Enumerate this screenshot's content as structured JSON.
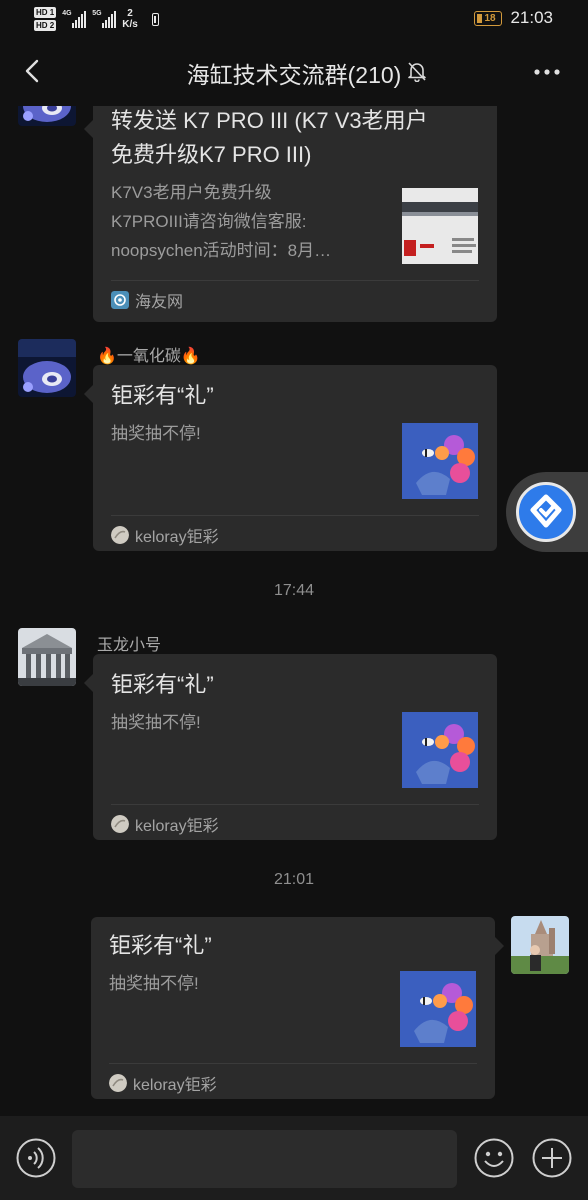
{
  "status_bar": {
    "sim1": "HD 1",
    "sim2": "HD 2",
    "net1": "4G",
    "net2": "5G",
    "speed_value": "2",
    "speed_unit": "K/s",
    "battery_level": "18",
    "time": "21:03"
  },
  "header": {
    "title": "海缸技术交流群(210)",
    "back_icon": "back-arrow-icon",
    "mute_icon": "bell-muted-icon",
    "more_icon": "more-dots-icon"
  },
  "messages": [
    {
      "type": "link_card",
      "side": "left",
      "title": "转发送 K7 PRO III (K7 V3老用户免费升级K7 PRO III)",
      "title_line1": "转发送 K7 PRO III (K7 V3老用户",
      "title_line2": "免费升级K7 PRO III)",
      "desc_line1": "K7V3老用户免费升级",
      "desc_line2": "K7PROIII请咨询微信客服:",
      "desc_line3": "noopsychen活动时间：8月…",
      "source": "海友网"
    },
    {
      "type": "link_card",
      "side": "left",
      "sender": "🔥一氧化碳🔥",
      "title": "钜彩有“礼”",
      "desc": "抽奖抽不停!",
      "source": "keloray钜彩"
    },
    {
      "type": "timestamp",
      "text": "17:44"
    },
    {
      "type": "link_card",
      "side": "left",
      "sender": "玉龙小号",
      "title": "钜彩有“礼”",
      "desc": "抽奖抽不停!",
      "source": "keloray钜彩"
    },
    {
      "type": "timestamp",
      "text": "21:01"
    },
    {
      "type": "link_card",
      "side": "right",
      "title": "钜彩有“礼”",
      "desc": "抽奖抽不停!",
      "source": "keloray钜彩"
    }
  ],
  "input_bar": {
    "voice_icon": "voice-icon",
    "input_value": "",
    "emoji_icon": "emoji-icon",
    "plus_icon": "plus-icon"
  },
  "colors": {
    "background": "#111111",
    "bubble": "#2b2b2b",
    "accent": "#2e7bea",
    "battery": "#d39a3c"
  }
}
